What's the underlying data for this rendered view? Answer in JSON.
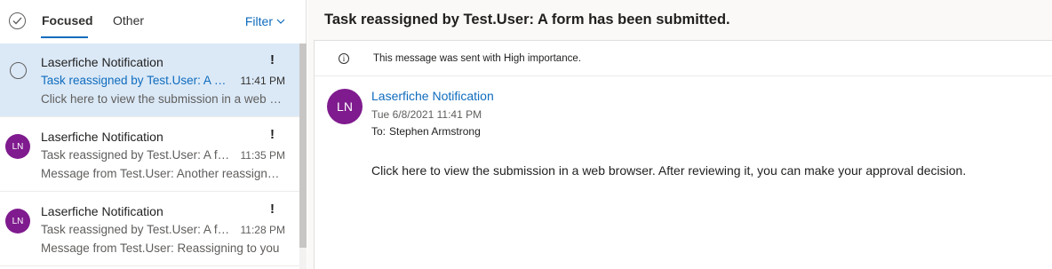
{
  "list_header": {
    "tabs": [
      {
        "label": "Focused",
        "active": true
      },
      {
        "label": "Other",
        "active": false
      }
    ],
    "filter_label": "Filter"
  },
  "messages": [
    {
      "sender": "Laserfiche Notification",
      "subject": "Task reassigned by Test.User: A form has been submitted.",
      "time": "11:41 PM",
      "preview": "Click here to view the submission in a web browser. After reviewing it, you can make your approval decision.",
      "important_mark": "!",
      "selected": true
    },
    {
      "sender": "Laserfiche Notification",
      "subject": "Task reassigned by Test.User: A form has been submitted.",
      "time": "11:35 PM",
      "preview": "Message from Test.User: Another reassignment",
      "important_mark": "!",
      "avatar_initials": "LN",
      "selected": false
    },
    {
      "sender": "Laserfiche Notification",
      "subject": "Task reassigned by Test.User: A form has been submitted.",
      "time": "11:28 PM",
      "preview": "Message from Test.User: Reassigning to you",
      "important_mark": "!",
      "avatar_initials": "LN",
      "selected": false
    }
  ],
  "reading": {
    "title": "Task reassigned by Test.User: A form has been submitted.",
    "importance_notice": "This message was sent with High importance.",
    "info_icon_glyph": "i",
    "avatar_initials": "LN",
    "from_name": "Laserfiche Notification",
    "sent_date": "Tue 6/8/2021 11:41 PM",
    "to_label": "To:",
    "to_name": "Stephen Armstrong",
    "body": "Click here to view the submission in a web browser. After reviewing it, you can make your approval decision."
  },
  "colors": {
    "accent": "#0f6cbd",
    "selected_bg": "#dbe9f7",
    "avatar_bg": "#7f1b8e"
  },
  "icons": {
    "select_all": "checkmark-circle-icon",
    "filter_chevron": "chevron-down-icon",
    "info": "info-icon"
  }
}
